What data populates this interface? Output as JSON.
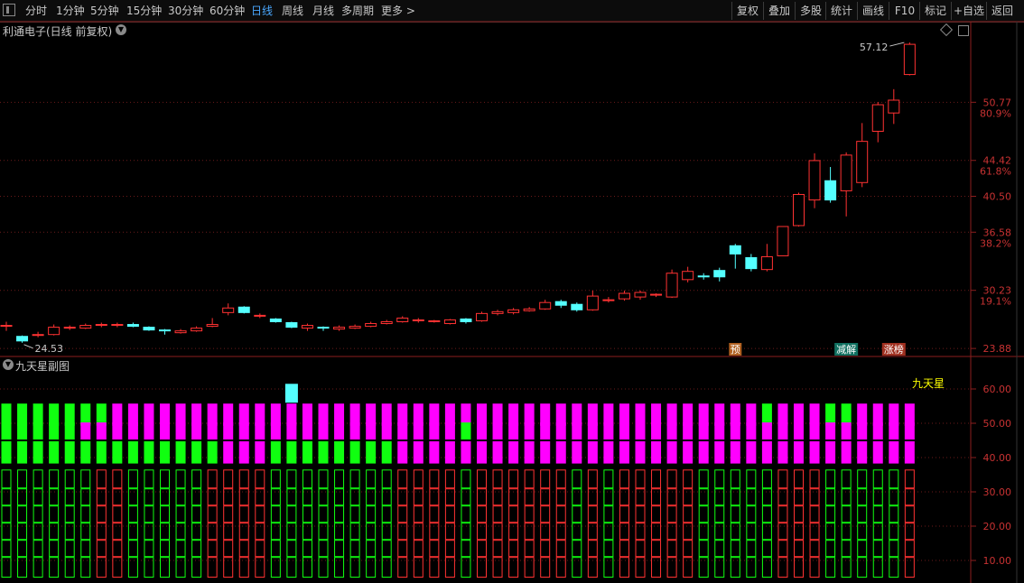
{
  "toolbar": {
    "periods": [
      "分时",
      "1分钟",
      "5分钟",
      "15分钟",
      "30分钟",
      "60分钟",
      "日线",
      "周线",
      "月线",
      "多周期",
      "更多 >"
    ],
    "active": "日线",
    "right_buttons": [
      "复权",
      "叠加",
      "多股",
      "统计",
      "画线",
      "F10",
      "标记",
      "+自选",
      "返回"
    ]
  },
  "stock": {
    "title": "利通电子(日线 前复权)"
  },
  "main_chart": {
    "price_labels": [
      {
        "label": "50.77",
        "pct": "80.9%"
      },
      {
        "label": "44.42",
        "pct": "61.8%"
      },
      {
        "label": "40.50",
        "pct": ""
      },
      {
        "label": "36.58",
        "pct": "38.2%"
      },
      {
        "label": "30.23",
        "pct": "19.1%"
      },
      {
        "label": "23.88",
        "pct": ""
      }
    ],
    "high_label": "57.12",
    "low_label": "24.53",
    "markers": [
      "预",
      "减解",
      "涨榜"
    ],
    "colors": {
      "up": "#ff3232",
      "down": "#54ffff",
      "grid": "#6a1a1a",
      "axis": "#8b1e1e"
    }
  },
  "chart_data": {
    "type": "candlestick",
    "price_range": [
      23.3,
      57.8
    ],
    "candles": [
      [
        26.3,
        26.4,
        26.8,
        25.8
      ],
      [
        25.2,
        24.7,
        25.3,
        24.5
      ],
      [
        25.3,
        25.4,
        25.7,
        25.1
      ],
      [
        25.4,
        26.2,
        26.5,
        25.3
      ],
      [
        26.1,
        26.2,
        26.4,
        25.9
      ],
      [
        26.1,
        26.4,
        26.6,
        26.0
      ],
      [
        26.4,
        26.5,
        26.7,
        26.2
      ],
      [
        26.4,
        26.5,
        26.7,
        26.2
      ],
      [
        26.5,
        26.3,
        26.7,
        26.2
      ],
      [
        26.2,
        25.9,
        26.3,
        25.8
      ],
      [
        25.9,
        25.8,
        26.0,
        25.4
      ],
      [
        25.6,
        25.8,
        26.0,
        25.5
      ],
      [
        25.8,
        26.1,
        26.3,
        25.7
      ],
      [
        26.3,
        26.5,
        27.2,
        26.2
      ],
      [
        27.8,
        28.3,
        28.8,
        27.5
      ],
      [
        28.4,
        27.8,
        28.5,
        27.7
      ],
      [
        27.4,
        27.5,
        27.7,
        27.2
      ],
      [
        27.1,
        26.8,
        27.2,
        26.7
      ],
      [
        26.7,
        26.2,
        26.8,
        26.1
      ],
      [
        26.1,
        26.4,
        26.6,
        25.8
      ],
      [
        26.2,
        26.1,
        26.3,
        25.8
      ],
      [
        26.0,
        26.2,
        26.4,
        25.8
      ],
      [
        26.1,
        26.3,
        26.5,
        26.0
      ],
      [
        26.3,
        26.6,
        26.8,
        26.2
      ],
      [
        26.6,
        26.8,
        27.0,
        26.5
      ],
      [
        26.8,
        27.2,
        27.4,
        26.7
      ],
      [
        27.0,
        27.0,
        27.2,
        26.7
      ],
      [
        26.9,
        26.9,
        27.0,
        26.7
      ],
      [
        26.6,
        27.0,
        27.1,
        26.5
      ],
      [
        27.1,
        26.8,
        27.2,
        26.6
      ],
      [
        26.9,
        27.7,
        27.9,
        26.8
      ],
      [
        27.7,
        27.9,
        28.1,
        27.5
      ],
      [
        27.8,
        28.1,
        28.3,
        27.6
      ],
      [
        28.0,
        28.2,
        28.4,
        27.9
      ],
      [
        28.2,
        28.9,
        29.2,
        28.1
      ],
      [
        29.0,
        28.6,
        29.2,
        28.3
      ],
      [
        28.7,
        28.1,
        28.9,
        27.9
      ],
      [
        28.1,
        29.6,
        30.2,
        28.0
      ],
      [
        29.1,
        29.2,
        29.5,
        28.9
      ],
      [
        29.3,
        29.9,
        30.2,
        29.1
      ],
      [
        29.5,
        30.0,
        30.2,
        29.2
      ],
      [
        29.7,
        29.8,
        29.9,
        29.5
      ],
      [
        29.5,
        32.1,
        32.5,
        29.4
      ],
      [
        31.4,
        32.3,
        32.8,
        31.1
      ],
      [
        31.8,
        31.7,
        32.1,
        31.4
      ],
      [
        32.4,
        31.7,
        32.7,
        31.2
      ],
      [
        35.1,
        34.2,
        35.3,
        32.6
      ],
      [
        33.8,
        32.6,
        34.2,
        32.3
      ],
      [
        32.5,
        33.9,
        35.3,
        32.3
      ],
      [
        34.0,
        37.2,
        37.2,
        34.0
      ],
      [
        37.3,
        40.7,
        40.9,
        37.2
      ],
      [
        40.1,
        44.4,
        45.2,
        39.2
      ],
      [
        42.2,
        40.1,
        43.7,
        39.8
      ],
      [
        41.1,
        45.0,
        45.3,
        38.3
      ],
      [
        42.0,
        46.5,
        48.5,
        41.5
      ],
      [
        47.6,
        50.5,
        50.8,
        46.4
      ],
      [
        49.6,
        51.0,
        52.2,
        48.4
      ],
      [
        53.8,
        57.1,
        57.3,
        53.7
      ]
    ],
    "sub_chart": {
      "title": "九天星副图",
      "series_label": "九天星",
      "y_ticks": [
        "60.00",
        "50.00",
        "40.00",
        "30.00",
        "20.00",
        "10.00"
      ],
      "y_range": [
        5,
        65
      ],
      "top_block": {
        "index": 18,
        "value": 60
      },
      "row_value_high": [
        50,
        40
      ],
      "row_value_mid": [
        40,
        30
      ],
      "row_value_low": [
        30,
        20
      ],
      "levels_top": [
        1,
        1,
        1,
        1,
        1,
        1,
        1,
        0,
        0,
        0,
        0,
        0,
        0,
        0,
        0,
        0,
        0,
        0,
        0,
        0,
        0,
        0,
        0,
        0,
        0,
        0,
        0,
        0,
        0,
        0,
        0,
        0,
        0,
        0,
        0,
        0,
        0,
        0,
        0,
        0,
        0,
        0,
        0,
        0,
        0,
        0,
        0,
        0,
        1,
        0,
        0,
        0,
        1,
        1,
        0,
        0,
        0,
        0
      ],
      "levels_mid": [
        1,
        1,
        1,
        1,
        1,
        0,
        0,
        0,
        0,
        0,
        0,
        0,
        0,
        0,
        0,
        0,
        0,
        0,
        0,
        0,
        0,
        0,
        0,
        0,
        0,
        0,
        0,
        0,
        0,
        1,
        0,
        0,
        0,
        0,
        0,
        0,
        0,
        0,
        0,
        0,
        0,
        0,
        0,
        0,
        0,
        0,
        0,
        0,
        0,
        0,
        0,
        0,
        0,
        0,
        0,
        0,
        0,
        0
      ],
      "levels_low": [
        1,
        1,
        1,
        1,
        1,
        1,
        1,
        1,
        1,
        1,
        1,
        1,
        1,
        1,
        0,
        0,
        0,
        1,
        1,
        1,
        1,
        1,
        1,
        1,
        1,
        0,
        0,
        0,
        0,
        0,
        0,
        0,
        0,
        0,
        0,
        0,
        0,
        0,
        0,
        0,
        0,
        0,
        0,
        0,
        0,
        0,
        0,
        0,
        0,
        0,
        0,
        0,
        0,
        0,
        0,
        0,
        0,
        0
      ],
      "outline_green_cols": [
        0,
        1,
        2,
        3,
        4,
        5,
        8,
        9,
        10,
        11,
        12,
        17,
        18,
        19,
        20,
        21,
        22,
        23,
        24,
        29,
        36,
        38,
        44,
        45,
        46,
        47,
        48,
        52,
        53,
        54,
        55,
        56
      ],
      "colors": {
        "green": "#10ff10",
        "magenta": "#ff00ff",
        "cyan": "#54ffff",
        "red_outline": "#ff3232",
        "green_outline": "#10ff10"
      }
    }
  }
}
